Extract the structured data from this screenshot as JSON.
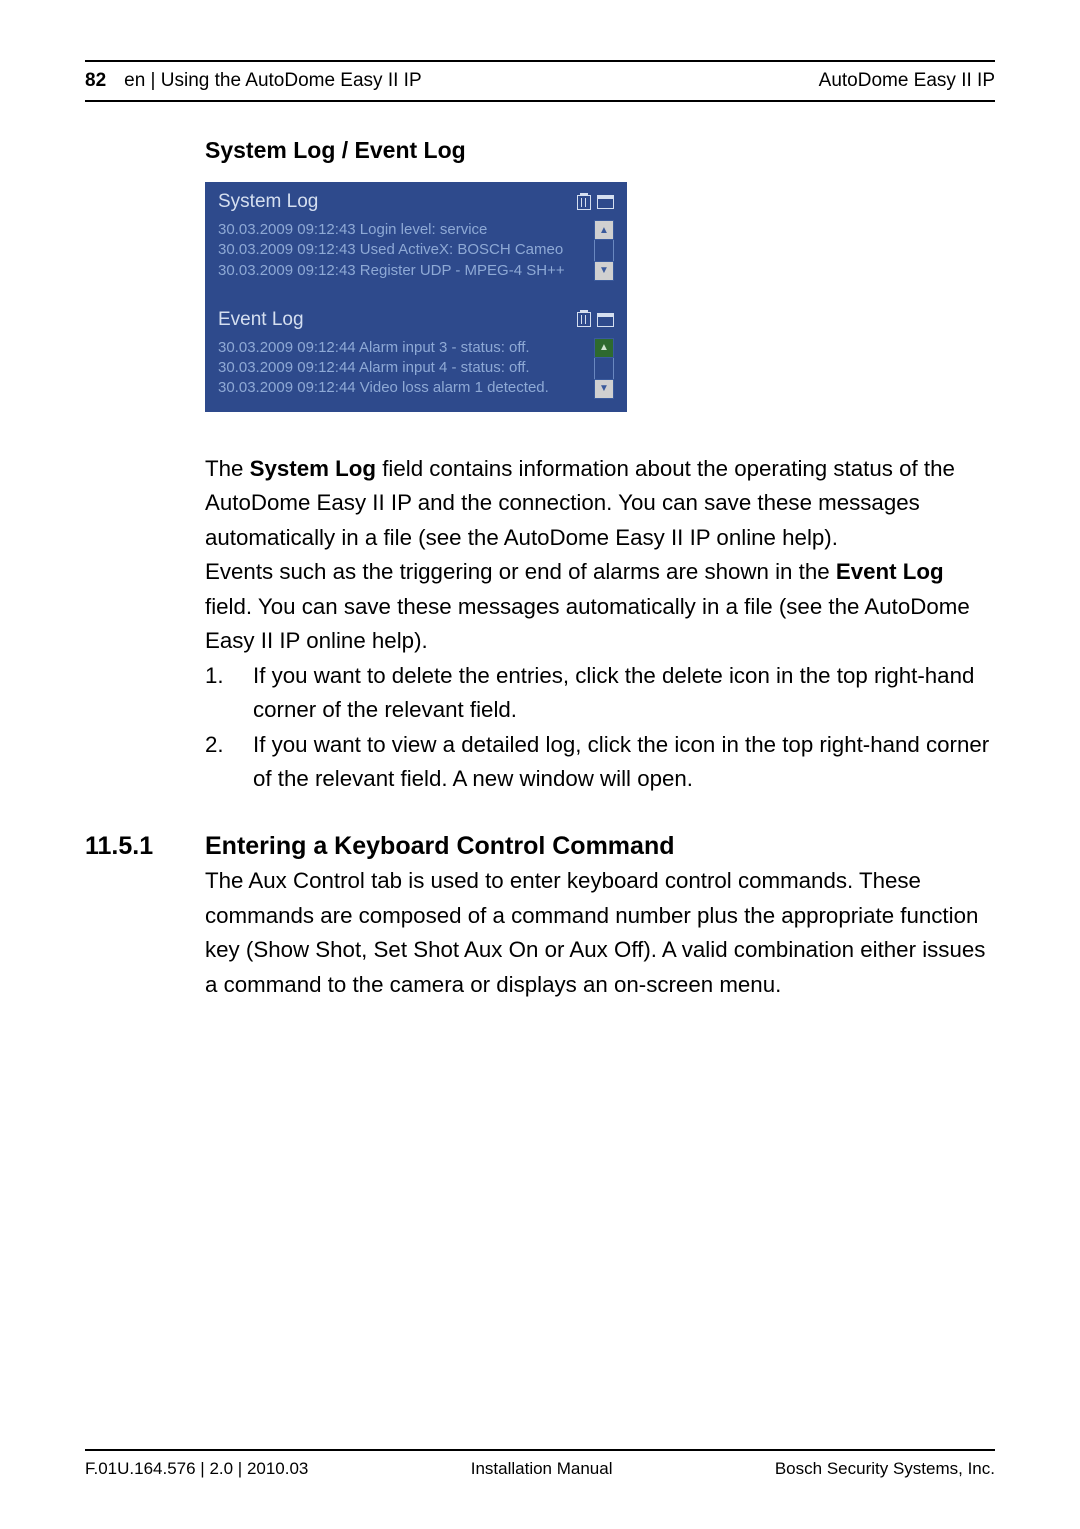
{
  "header": {
    "page_num": "82",
    "breadcrumb": "en | Using the AutoDome Easy II IP",
    "product": "AutoDome Easy II IP"
  },
  "section_title": "System Log / Event Log",
  "system_log": {
    "title": "System Log",
    "lines": "30.03.2009 09:12:43 Login level: service\n30.03.2009 09:12:43 Used ActiveX: BOSCH Cameo\n30.03.2009 09:12:43 Register UDP - MPEG-4 SH++"
  },
  "event_log": {
    "title": "Event Log",
    "lines": "30.03.2009 09:12:44 Alarm input 3 - status: off.\n30.03.2009 09:12:44 Alarm input 4 - status: off.\n30.03.2009 09:12:44 Video loss alarm 1 detected."
  },
  "body": {
    "p1_pre": "The ",
    "p1_bold": "System Log",
    "p1_post": " field contains information about the operating status of the AutoDome Easy II IP and the connection. You can save these messages automatically in a file (see the AutoDome Easy II IP online help).",
    "p2_pre": "Events such as the triggering or end of alarms are shown in the ",
    "p2_bold": "Event Log",
    "p2_post": " field. You can save these messages automatically in a file (see the AutoDome Easy II IP online help).",
    "li1_num": "1.",
    "li1": "If you want to delete the entries, click the delete icon in the top right-hand corner of the relevant field.",
    "li2_num": "2.",
    "li2": "If you want to view a detailed log, click the icon in the top right-hand corner of the relevant field. A new window will open."
  },
  "subsection": {
    "num": "11.5.1",
    "title": "Entering a Keyboard Control Command",
    "text": "The Aux Control tab is used to enter keyboard control commands. These commands are composed of a command number plus the appropriate function key (Show Shot, Set Shot Aux On or Aux Off). A valid combination either issues a command to the camera or displays an on-screen menu."
  },
  "footer": {
    "left": "F.01U.164.576 | 2.0 | 2010.03",
    "center": "Installation Manual",
    "right": "Bosch Security Systems, Inc."
  },
  "icons": {
    "up": "▲",
    "down": "▼"
  }
}
